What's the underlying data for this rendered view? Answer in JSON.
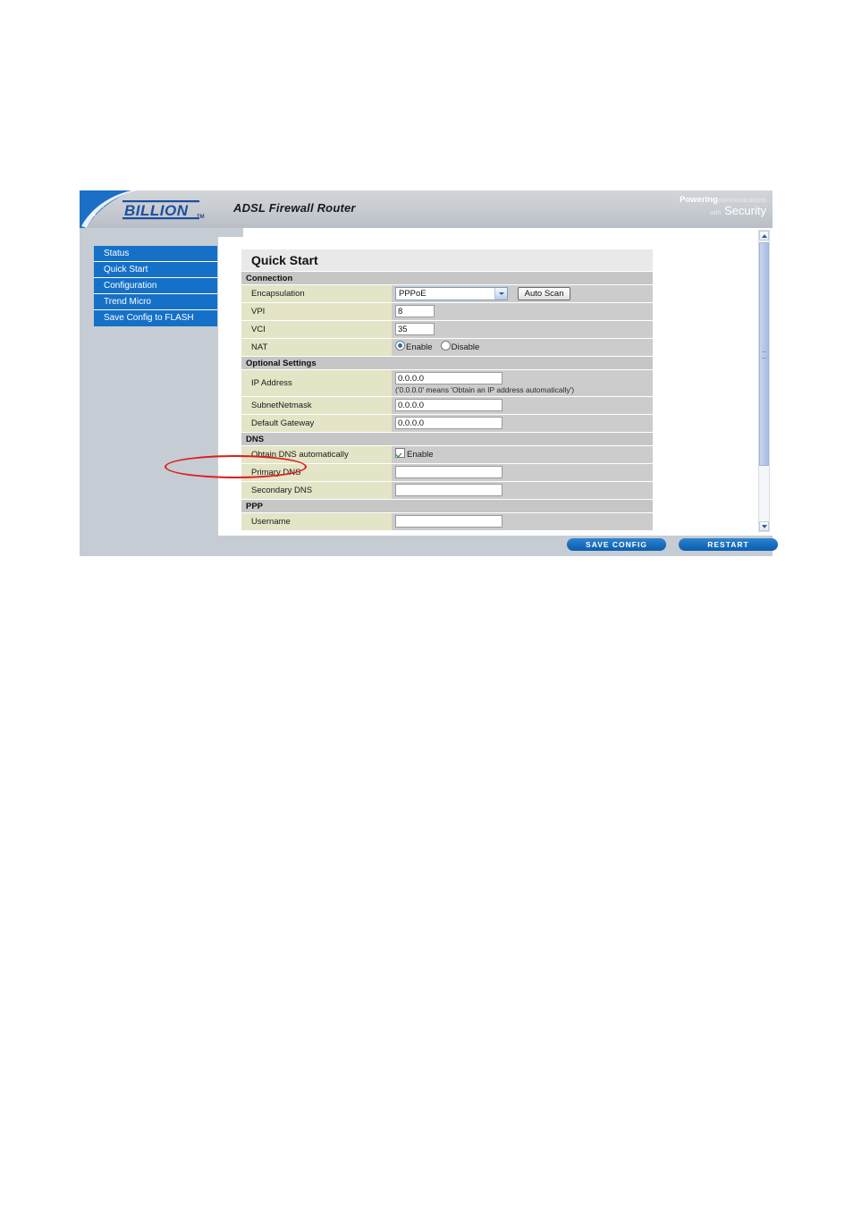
{
  "header": {
    "brand": "BILLION",
    "brand_tm": "TM",
    "title": "ADSL Firewall Router",
    "tagline_line1_bold": "Powering",
    "tagline_line1_thin": "communications",
    "tagline_line2_thin": "with",
    "tagline_line2_bold": "Security"
  },
  "sidebar": {
    "items": [
      {
        "label": "Status"
      },
      {
        "label": "Quick Start"
      },
      {
        "label": "Configuration"
      },
      {
        "label": "Trend Micro"
      },
      {
        "label": "Save Config to FLASH"
      }
    ],
    "selected": "Quick Start"
  },
  "page": {
    "title": "Quick Start"
  },
  "sections": {
    "connection": {
      "heading": "Connection",
      "encapsulation_label": "Encapsulation",
      "encapsulation_value": "PPPoE",
      "auto_scan_label": "Auto Scan",
      "vpi_label": "VPI",
      "vpi_value": "8",
      "vci_label": "VCI",
      "vci_value": "35",
      "nat_label": "NAT",
      "nat_enable_label": "Enable",
      "nat_disable_label": "Disable",
      "nat_selected": "Enable"
    },
    "optional": {
      "heading": "Optional Settings",
      "ip_label": "IP Address",
      "ip_value": "0.0.0.0",
      "ip_hint": "('0.0.0.0' means 'Obtain an IP address automatically')",
      "netmask_label": "SubnetNetmask",
      "netmask_value": "0.0.0.0",
      "gateway_label": "Default Gateway",
      "gateway_value": "0.0.0.0"
    },
    "dns": {
      "heading": "DNS",
      "obtain_label": "Obtain DNS automatically",
      "obtain_checkbox_label": "Enable",
      "obtain_checked": true,
      "primary_label": "Primary DNS",
      "primary_value": "",
      "secondary_label": "Secondary DNS",
      "secondary_value": ""
    },
    "ppp": {
      "heading": "PPP",
      "username_label": "Username",
      "username_value": ""
    }
  },
  "footer": {
    "save_label": "SAVE CONFIG",
    "restart_label": "RESTART"
  },
  "colors": {
    "nav_blue": "#1570c8",
    "label_khaki": "#e4e4c6",
    "value_gray": "#cccccc",
    "section_gray": "#c6c6c6",
    "annotation_red": "#e01b1b"
  }
}
